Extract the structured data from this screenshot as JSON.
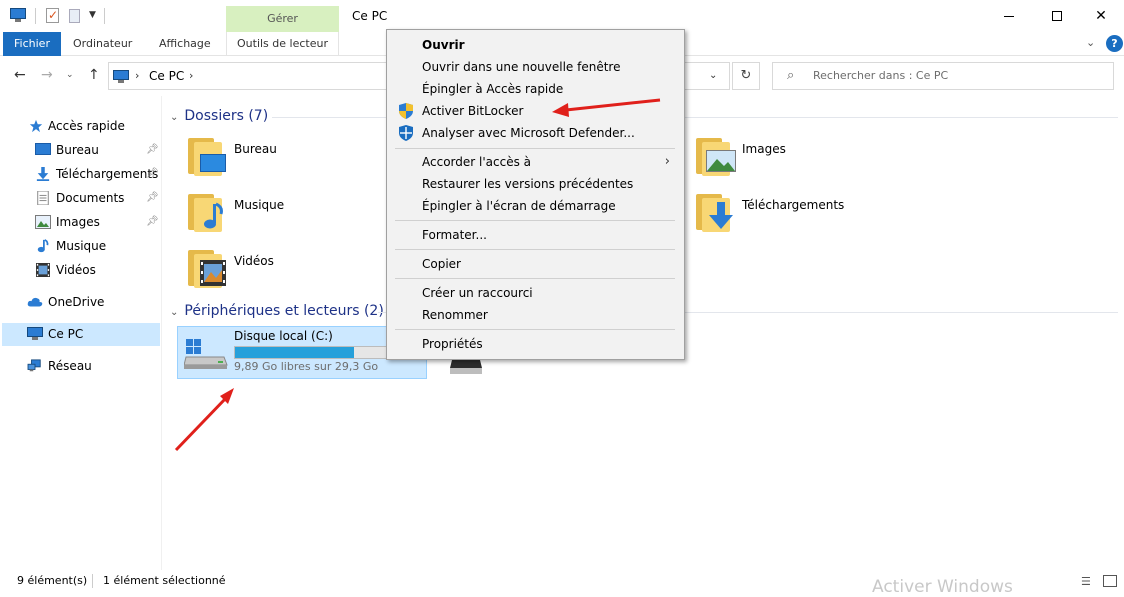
{
  "titlebar": {
    "contextual_tab": "Gérer",
    "title": "Ce PC"
  },
  "ribbon": {
    "tabs": [
      "Fichier",
      "Ordinateur",
      "Affichage",
      "Outils de lecteur"
    ]
  },
  "address": {
    "crumb": "Ce PC",
    "search_placeholder": "Rechercher dans : Ce PC"
  },
  "sidebar": {
    "quick_access": "Accès rapide",
    "items": [
      {
        "label": "Bureau",
        "icon": "desktop-icon",
        "pinned": true
      },
      {
        "label": "Téléchargements",
        "icon": "downloads-icon",
        "pinned": true
      },
      {
        "label": "Documents",
        "icon": "documents-icon",
        "pinned": true
      },
      {
        "label": "Images",
        "icon": "pictures-icon",
        "pinned": true
      },
      {
        "label": "Musique",
        "icon": "music-icon",
        "pinned": false
      },
      {
        "label": "Vidéos",
        "icon": "videos-icon",
        "pinned": false
      }
    ],
    "onedrive": "OneDrive",
    "this_pc": "Ce PC",
    "network": "Réseau"
  },
  "content": {
    "folders_header": "Dossiers (7)",
    "folders": [
      "Bureau",
      "Musique",
      "Vidéos",
      "Images",
      "Téléchargements"
    ],
    "devices_header": "Périphériques et lecteurs (2)",
    "drive": {
      "name": "Disque local (C:)",
      "free_text": "9,89 Go libres sur 29,3 Go",
      "used_fraction": 0.66
    }
  },
  "context_menu": {
    "items": [
      "Ouvrir",
      "Ouvrir dans une nouvelle fenêtre",
      "Épingler à Accès rapide",
      "Activer BitLocker",
      "Analyser avec Microsoft Defender...",
      "Accorder l'accès à",
      "Restaurer les versions précédentes",
      "Épingler à l'écran de démarrage",
      "Formater...",
      "Copier",
      "Créer un raccourci",
      "Renommer",
      "Propriétés"
    ]
  },
  "statusbar": {
    "count": "9 élément(s)",
    "selection": "1 élément sélectionné",
    "watermark": "Activer Windows"
  },
  "colors": {
    "accent": "#1a6dc0",
    "selection": "#cce8ff",
    "drive_fill": "#26a0da",
    "annotation_arrow": "#e0201b"
  }
}
